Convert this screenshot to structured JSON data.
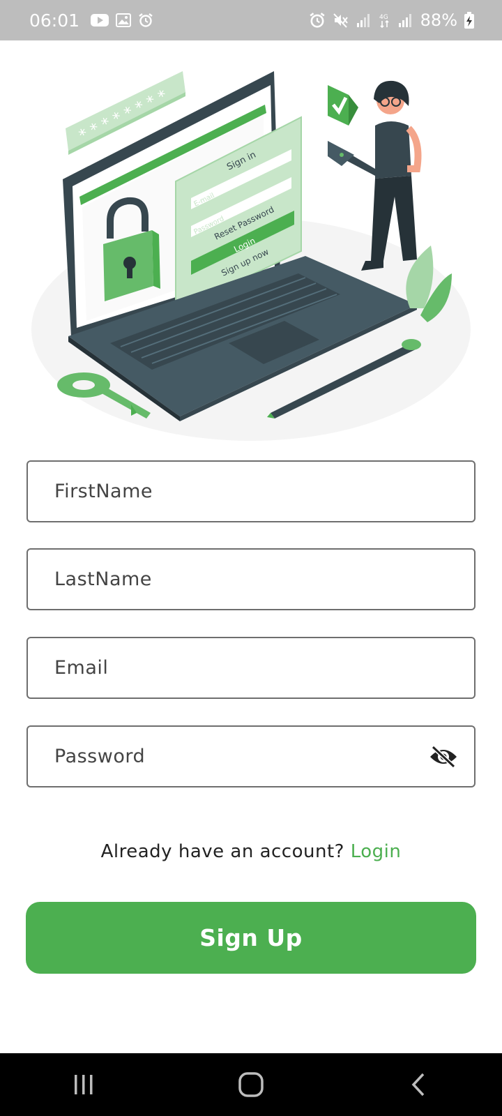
{
  "status_bar": {
    "time": "06:01",
    "battery": "88%",
    "left_icons": [
      "youtube-icon",
      "gallery-icon",
      "alarm-icon"
    ],
    "right_icons": [
      "alarm-icon",
      "mute-icon",
      "signal-icon",
      "4g-signal-icon",
      "signal-icon",
      "battery-charging-icon"
    ]
  },
  "illustration": {
    "form_title": "Sign in",
    "email_placeholder": "E-mail",
    "password_placeholder": "Password",
    "reset_label": "Reset Password",
    "login_label": "Login",
    "signup_label": "Sign up now",
    "accent_color": "#4caf50",
    "dark_color": "#37474f"
  },
  "form": {
    "first_name": {
      "placeholder": "FirstName",
      "value": ""
    },
    "last_name": {
      "placeholder": "LastName",
      "value": ""
    },
    "email": {
      "placeholder": "Email",
      "value": ""
    },
    "password": {
      "placeholder": "Password",
      "value": "",
      "toggle_icon": "eye-off-icon"
    }
  },
  "login_prompt": {
    "text": "Already have an account? ",
    "link": "Login"
  },
  "signup_button": {
    "label": "Sign Up",
    "color": "#4caf50"
  },
  "nav_bar": {
    "buttons": [
      "recent-apps-icon",
      "home-icon",
      "back-icon"
    ]
  }
}
